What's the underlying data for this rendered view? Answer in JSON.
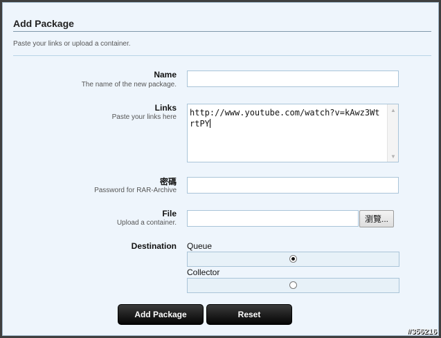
{
  "panel": {
    "title": "Add Package",
    "subtitle": "Paste your links or upload a container."
  },
  "fields": {
    "name": {
      "label": "Name",
      "description": "The name of the new package.",
      "value": ""
    },
    "links": {
      "label": "Links",
      "description": "Paste your links here",
      "value": "http://www.youtube.com/watch?v=kAwz3WtrtPY"
    },
    "password": {
      "label": "密碼",
      "description": "Password for RAR-Archive",
      "value": ""
    },
    "file": {
      "label": "File",
      "description": "Upload a container.",
      "value": "",
      "browse_label": "瀏覽..."
    }
  },
  "destination": {
    "label": "Destination",
    "options": [
      {
        "label": "Queue",
        "checked": true
      },
      {
        "label": "Collector",
        "checked": false
      }
    ]
  },
  "buttons": {
    "add": "Add Package",
    "reset": "Reset"
  },
  "watermark": "#356216",
  "icons": {
    "scroll_up": "chevron-up-icon",
    "scroll_down": "chevron-down-icon"
  }
}
